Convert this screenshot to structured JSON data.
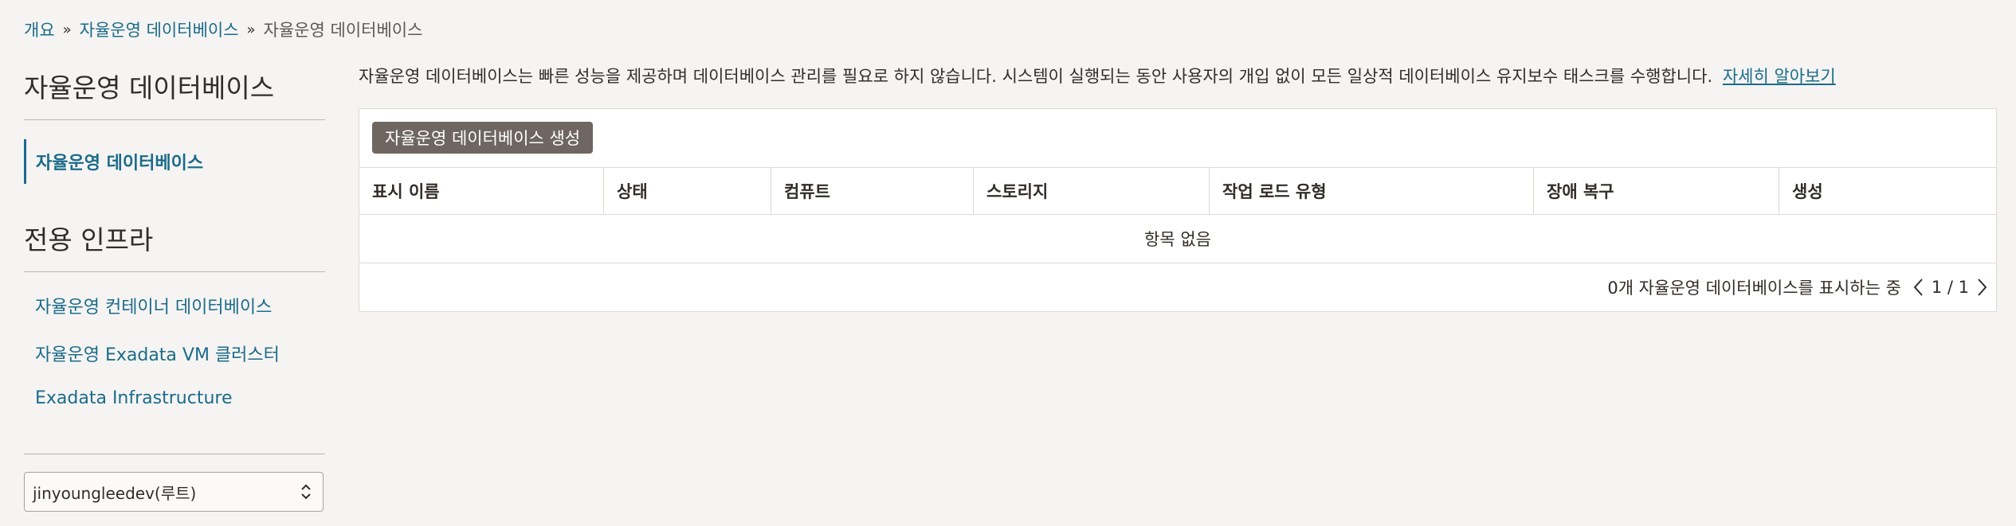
{
  "breadcrumb": {
    "items": [
      "개요",
      "자율운영 데이터베이스"
    ],
    "separator": "»",
    "current": "자율운영 데이터베이스"
  },
  "sidebar": {
    "title": "자율운영 데이터베이스",
    "active_item": "자율운영 데이터베이스",
    "section2_title": "전용 인프라",
    "links": [
      "자율운영 컨테이너 데이터베이스",
      "자율운영 Exadata VM 클러스터",
      "Exadata Infrastructure"
    ],
    "compartment": "jinyoungleedev(루트)"
  },
  "main": {
    "description": "자율운영 데이터베이스는 빠른 성능을 제공하며 데이터베이스 관리를 필요로 하지 않습니다. 시스템이 실행되는 동안 사용자의 개입 없이 모든 일상적 데이터베이스 유지보수 태스크를 수행합니다.",
    "learn_more": "자세히 알아보기",
    "create_button": "자율운영 데이터베이스 생성",
    "columns": [
      "표시 이름",
      "상태",
      "컴퓨트",
      "스토리지",
      "작업 로드 유형",
      "장애 복구",
      "생성"
    ],
    "empty_text": "항목 없음",
    "footer_text": "0개 자율운영 데이터베이스를 표시하는 중",
    "page_indicator": "1 / 1"
  },
  "icons": {
    "compartment_select": "chevron-updown-icon",
    "prev_page": "chevron-left-icon",
    "next_page": "chevron-right-icon"
  },
  "colors": {
    "link": "#1b6b8a",
    "button_bg": "#6f6661",
    "page_bg": "#f5f4f2"
  }
}
